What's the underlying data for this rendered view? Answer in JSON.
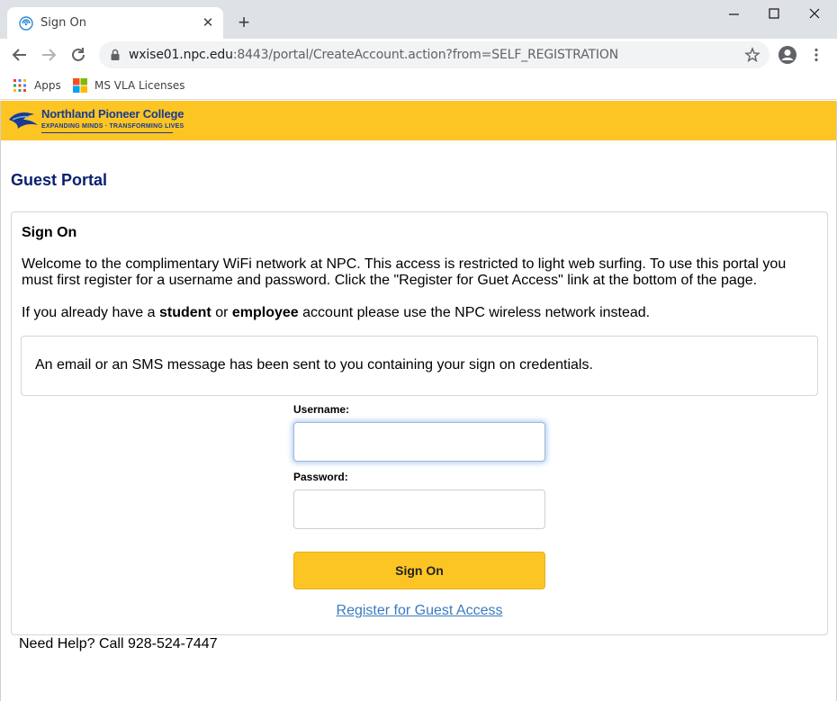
{
  "browser": {
    "tab_title": "Sign On",
    "url_host": "wxise01.npc.edu",
    "url_rest": ":8443/portal/CreateAccount.action?from=SELF_REGISTRATION",
    "bookmarks": [
      {
        "label": "Apps",
        "icon": "apps-grid-icon"
      },
      {
        "label": "MS VLA Licenses",
        "icon": "microsoft-logo-icon"
      }
    ]
  },
  "banner": {
    "college_name": "Northland Pioneer College",
    "tagline": "EXPANDING MINDS · TRANSFORMING LIVES",
    "color": "#fcc523"
  },
  "portal": {
    "title": "Guest Portal",
    "card_title": "Sign On",
    "welcome": "Welcome to the complimentary WiFi network at NPC. This access is restricted to light web surfing. To use this portal you must first register for a username and password. Click the \"Register for Guet Access\" link at the bottom of the page.",
    "already_prefix": "If you already have a ",
    "already_student": "student",
    "already_or": " or ",
    "already_employee": "employee",
    "already_suffix": " account please use the NPC wireless network instead.",
    "notice": "An email or an SMS message has been sent to you containing your sign on credentials.",
    "username_label": "Username:",
    "username_value": "",
    "password_label": "Password:",
    "password_value": "",
    "sign_on_button": "Sign On",
    "register_link": "Register for Guest Access",
    "help": "Need Help? Call 928-524-7447"
  },
  "colors": {
    "accent_yellow": "#fcc523",
    "title_navy": "#0a1f6e",
    "link_blue": "#3b7bbf"
  }
}
